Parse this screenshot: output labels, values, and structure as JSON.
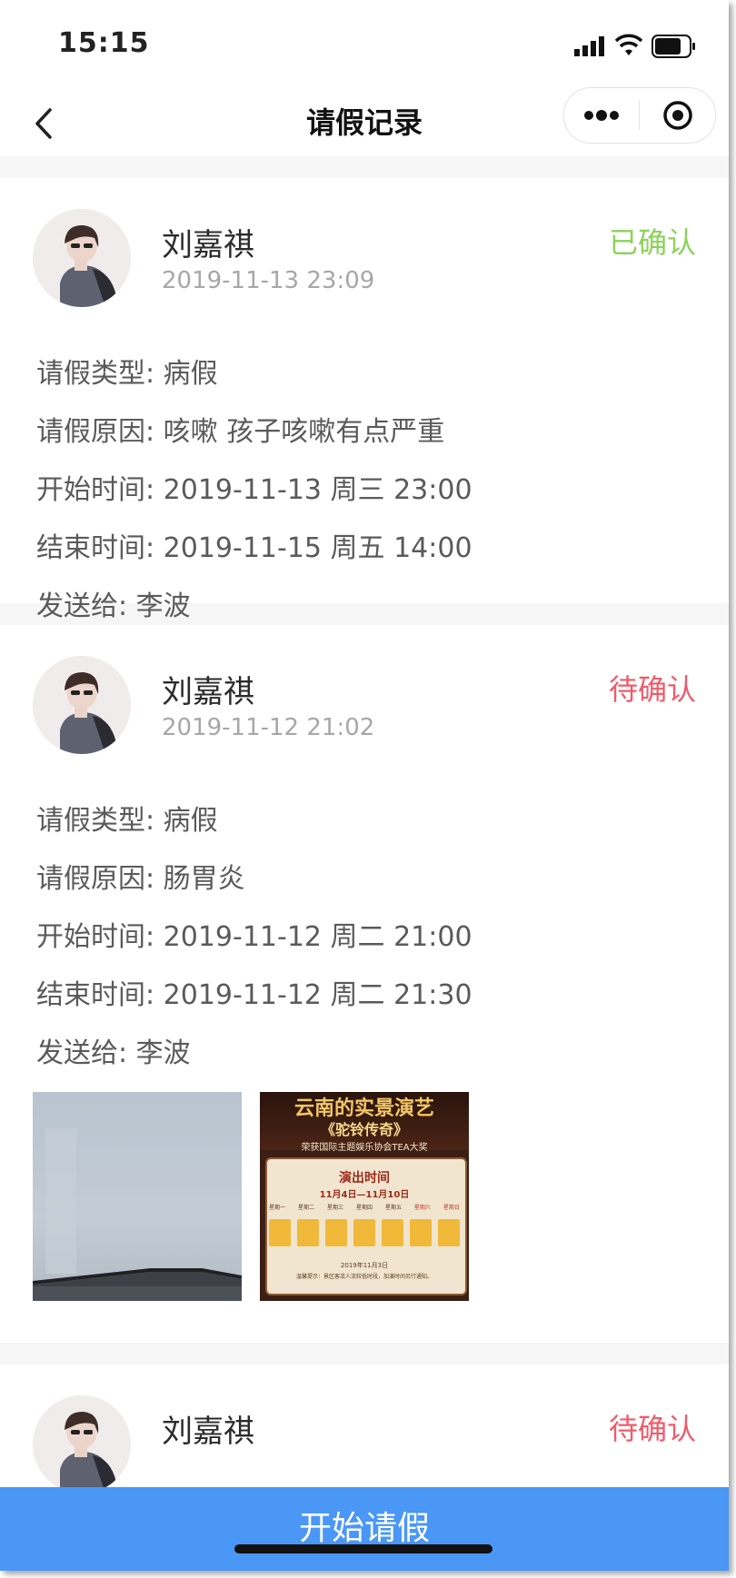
{
  "status_bar": {
    "time": "15:15"
  },
  "nav": {
    "title": "请假记录"
  },
  "colors": {
    "confirmed": "#8bd25b",
    "pending": "#ef5b6a",
    "bottom_button": "#4a97f5"
  },
  "records": [
    {
      "name": "刘嘉祺",
      "time": "2019-11-13 23:09",
      "status": "已确认",
      "type_label": "请假类型:",
      "type": "病假",
      "reason_label": "请假原因:",
      "reason": "咳嗽 孩子咳嗽有点严重",
      "start_label": "开始时间:",
      "start": "2019-11-13 周三 23:00",
      "end_label": "结束时间:",
      "end": "2019-11-15 周五 14:00",
      "to_label": "发送给:",
      "to": "李波"
    },
    {
      "name": "刘嘉祺",
      "time": "2019-11-12 21:02",
      "status": "待确认",
      "type_label": "请假类型:",
      "type": "病假",
      "reason_label": "请假原因:",
      "reason": "肠胃炎",
      "start_label": "开始时间:",
      "start": "2019-11-12 周二 21:00",
      "end_label": "结束时间:",
      "end": "2019-11-12 周二 21:30",
      "to_label": "发送给:",
      "to": "李波",
      "poster": {
        "headline": "云南的实景演艺",
        "subtitle": "《驼铃传奇》",
        "award": "荣获国际主题娱乐协会TEA大奖",
        "section": "演出时间",
        "dates": "11月4日—11月10日",
        "days": [
          "星期一",
          "星期二",
          "星期三",
          "星期四",
          "星期五",
          "星期六",
          "星期日"
        ],
        "footer_date": "2019年11月3日",
        "footer_note": "温馨提示：景区客流人流较低时段，加演时间另行通知。"
      }
    },
    {
      "name": "刘嘉祺",
      "status": "待确认"
    }
  ],
  "bottom": {
    "button_label": "开始请假"
  }
}
